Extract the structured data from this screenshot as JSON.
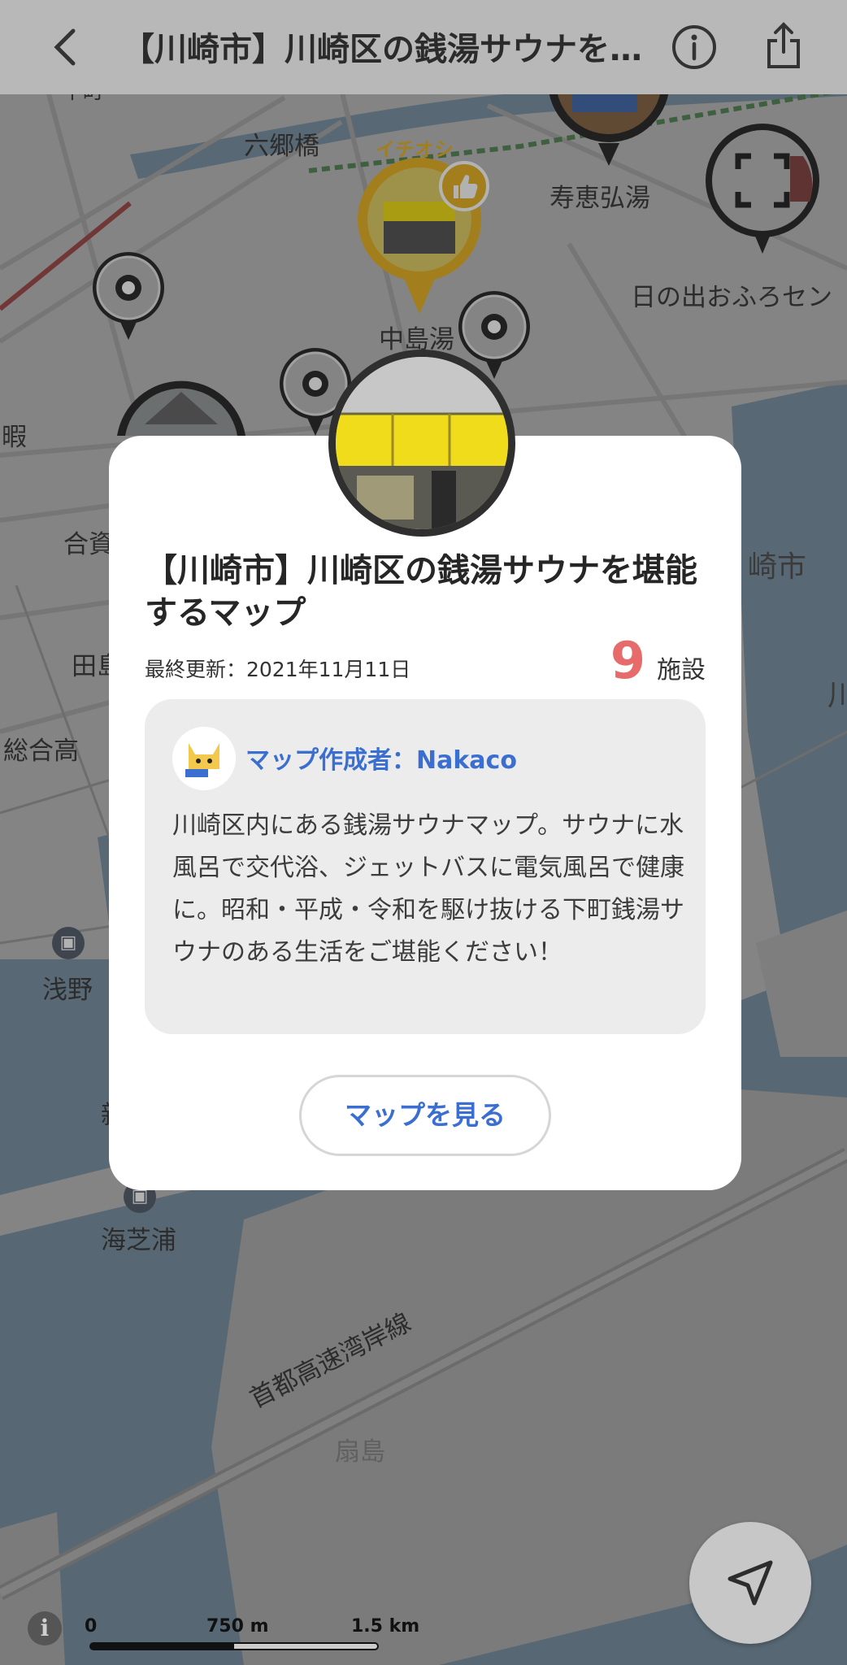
{
  "topbar": {
    "title": "【川崎市】川崎区の銭湯サウナを…",
    "back_icon": "chevron-left-icon",
    "info_icon": "info-icon",
    "share_icon": "share-icon"
  },
  "map": {
    "labels": {
      "rokugo_bashi": "六郷橋",
      "kotobuki": "寿恵弘湯",
      "hinode": "日の出おふろセン",
      "nakajima": "中島湯",
      "kawasaki_edge": "崎市",
      "ai": "合資",
      "den": "田島",
      "sogo": "総合高",
      "asano": "浅野",
      "kaishiba": "海芝浦",
      "shuto": "首都高速湾岸線",
      "ogishima": "扇島",
      "left_fragment": "暇",
      "shin_fragment": "新",
      "kawa_fragment": "川",
      "top_fragment": "平町"
    },
    "featured_badge": "イチオシ",
    "scale": {
      "zero": "0",
      "mid": "750 m",
      "max": "1.5 km",
      "fill_fraction": 0.5
    }
  },
  "card": {
    "title": "【川崎市】川崎区の銭湯サウナを堪能するマップ",
    "updated": "最終更新：2021年11月11日",
    "count": "9",
    "count_unit": "施設",
    "author": "マップ作成者：Nakaco",
    "description": "川崎区内にある銭湯サウナマップ。サウナに水風呂で交代浴、ジェットバスに電気風呂で健康に。昭和・平成・令和を駆け抜ける下町銭湯サウナのある生活をご堪能ください！",
    "view_button": "マップを見る"
  },
  "colors": {
    "accent_blue": "#3a6fd1",
    "count_red": "#e86b6b",
    "featured_gold": "#e9b52a",
    "pin_dark": "#2f2f2f"
  }
}
